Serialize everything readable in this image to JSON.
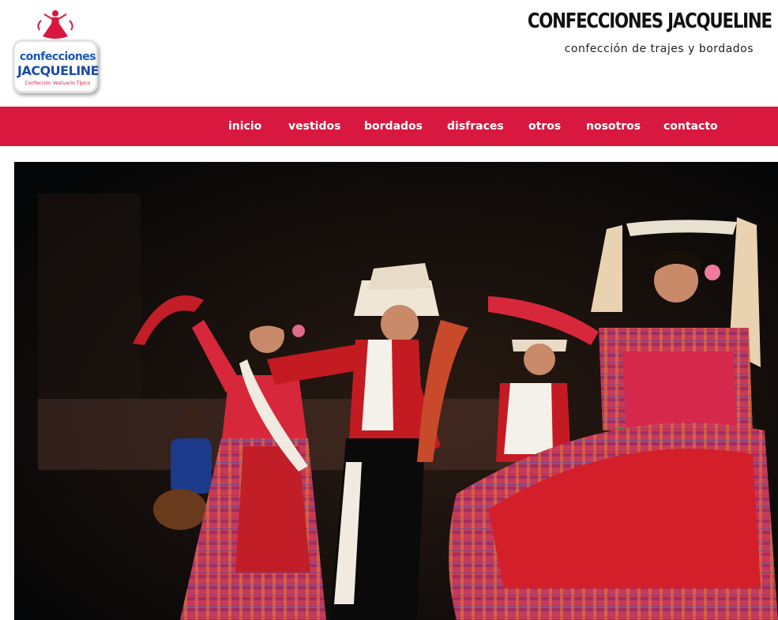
{
  "header": {
    "logo": {
      "line1": "confecciones",
      "line2": "JACQUELINE",
      "line3": "Confección Vestuario Típico"
    },
    "title": "CONFECCIONES JACQUELINE",
    "tagline": "confección de trajes y bordados"
  },
  "nav": {
    "items": [
      {
        "label": "inicio"
      },
      {
        "label": "vestidos"
      },
      {
        "label": "bordados"
      },
      {
        "label": "disfraces"
      },
      {
        "label": "otros"
      },
      {
        "label": "nosotros"
      },
      {
        "label": "contacto"
      }
    ]
  },
  "colors": {
    "brand_red": "#d8183f",
    "logo_blue": "#1d56b8"
  }
}
